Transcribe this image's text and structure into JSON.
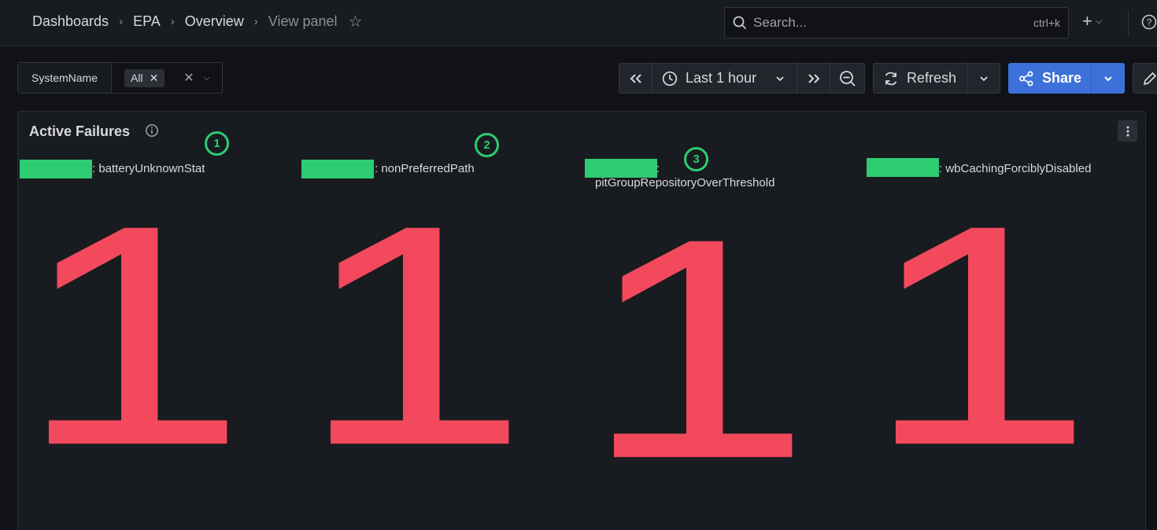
{
  "header": {
    "breadcrumb": [
      "Dashboards",
      "EPA",
      "Overview",
      "View panel"
    ],
    "search_placeholder": "Search...",
    "search_shortcut": "ctrl+k",
    "add_label": "+"
  },
  "variables": {
    "label": "SystemName",
    "selected": "All"
  },
  "time_controls": {
    "range": "Last 1 hour",
    "refresh_label": "Refresh",
    "share_label": "Share"
  },
  "panel": {
    "title": "Active Failures",
    "stats": [
      {
        "label": ": batteryUnknownStat",
        "value": "1"
      },
      {
        "label": ": nonPreferredPath",
        "value": "1"
      },
      {
        "label": ":",
        "label2": "pitGroupRepositoryOverThreshold",
        "value": "1"
      },
      {
        "label": ": wbCachingForciblyDisabled",
        "value": "1"
      }
    ]
  },
  "annotations": [
    "1",
    "2",
    "3"
  ],
  "colors": {
    "stat_value": "#f2495c",
    "redaction": "#2ecc71",
    "primary_button": "#3d71d9",
    "background": "#111217",
    "panel": "#181b1f"
  }
}
